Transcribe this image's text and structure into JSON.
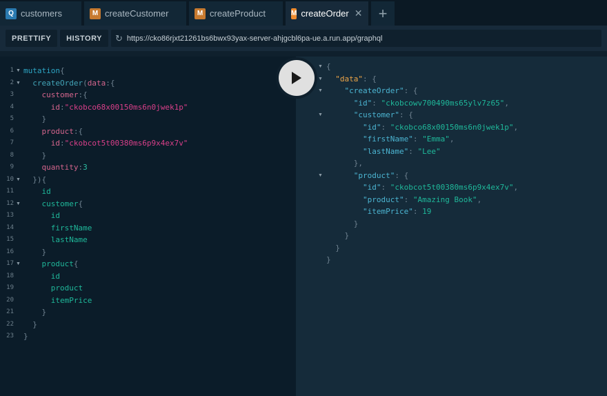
{
  "tabs": [
    {
      "badge": "Q",
      "label": "customers",
      "active": false
    },
    {
      "badge": "M",
      "label": "createCustomer",
      "active": false
    },
    {
      "badge": "M",
      "label": "createProduct",
      "active": false
    },
    {
      "badge": "M",
      "label": "createOrder",
      "active": true
    }
  ],
  "tab_add_label": "+",
  "tab_close_label": "✕",
  "toolbar": {
    "prettify_label": "PRETTIFY",
    "history_label": "HISTORY",
    "url": "https://cko86rjxt21261bs6bwx93yax-server-ahjgcbl6pa-ue.a.run.app/graphql"
  },
  "query_lines": [
    {
      "n": "1",
      "fold": true,
      "tokens": [
        [
          "kw",
          "mutation"
        ],
        [
          "pun",
          "{"
        ]
      ]
    },
    {
      "n": "2",
      "fold": true,
      "tokens": [
        [
          "pun",
          "  "
        ],
        [
          "fn",
          "createOrder"
        ],
        [
          "pun",
          "("
        ],
        [
          "arg",
          "data"
        ],
        [
          "pun",
          ":{"
        ]
      ]
    },
    {
      "n": "3",
      "fold": false,
      "tokens": [
        [
          "pun",
          "    "
        ],
        [
          "arg",
          "customer"
        ],
        [
          "pun",
          ":{"
        ]
      ]
    },
    {
      "n": "4",
      "fold": false,
      "tokens": [
        [
          "pun",
          "      "
        ],
        [
          "arg",
          "id"
        ],
        [
          "pun",
          ":"
        ],
        [
          "str",
          "\"ckobco68x00150ms6n0jwek1p\""
        ]
      ]
    },
    {
      "n": "5",
      "fold": false,
      "tokens": [
        [
          "pun",
          "    }"
        ]
      ]
    },
    {
      "n": "6",
      "fold": false,
      "tokens": [
        [
          "pun",
          "    "
        ],
        [
          "arg",
          "product"
        ],
        [
          "pun",
          ":{"
        ]
      ]
    },
    {
      "n": "7",
      "fold": false,
      "tokens": [
        [
          "pun",
          "      "
        ],
        [
          "arg",
          "id"
        ],
        [
          "pun",
          ":"
        ],
        [
          "str",
          "\"ckobcot5t00380ms6p9x4ex7v\""
        ]
      ]
    },
    {
      "n": "8",
      "fold": false,
      "tokens": [
        [
          "pun",
          "    }"
        ]
      ]
    },
    {
      "n": "9",
      "fold": false,
      "tokens": [
        [
          "pun",
          "    "
        ],
        [
          "arg",
          "quantity"
        ],
        [
          "pun",
          ":"
        ],
        [
          "num",
          "3"
        ]
      ]
    },
    {
      "n": "10",
      "fold": true,
      "tokens": [
        [
          "pun",
          "  }){"
        ]
      ]
    },
    {
      "n": "11",
      "fold": false,
      "tokens": [
        [
          "pun",
          "    "
        ],
        [
          "fld",
          "id"
        ]
      ]
    },
    {
      "n": "12",
      "fold": true,
      "tokens": [
        [
          "pun",
          "    "
        ],
        [
          "fld",
          "customer"
        ],
        [
          "pun",
          "{"
        ]
      ]
    },
    {
      "n": "13",
      "fold": false,
      "tokens": [
        [
          "pun",
          "      "
        ],
        [
          "fld",
          "id"
        ]
      ]
    },
    {
      "n": "14",
      "fold": false,
      "tokens": [
        [
          "pun",
          "      "
        ],
        [
          "fld",
          "firstName"
        ]
      ]
    },
    {
      "n": "15",
      "fold": false,
      "tokens": [
        [
          "pun",
          "      "
        ],
        [
          "fld",
          "lastName"
        ]
      ]
    },
    {
      "n": "16",
      "fold": false,
      "tokens": [
        [
          "pun",
          "    }"
        ]
      ]
    },
    {
      "n": "17",
      "fold": true,
      "tokens": [
        [
          "pun",
          "    "
        ],
        [
          "fld",
          "product"
        ],
        [
          "pun",
          "{"
        ]
      ]
    },
    {
      "n": "18",
      "fold": false,
      "tokens": [
        [
          "pun",
          "      "
        ],
        [
          "fld",
          "id"
        ]
      ]
    },
    {
      "n": "19",
      "fold": false,
      "tokens": [
        [
          "pun",
          "      "
        ],
        [
          "fld",
          "product"
        ]
      ]
    },
    {
      "n": "20",
      "fold": false,
      "tokens": [
        [
          "pun",
          "      "
        ],
        [
          "fld",
          "itemPrice"
        ]
      ]
    },
    {
      "n": "21",
      "fold": false,
      "tokens": [
        [
          "pun",
          "    }"
        ]
      ]
    },
    {
      "n": "22",
      "fold": false,
      "tokens": [
        [
          "pun",
          "  }"
        ]
      ]
    },
    {
      "n": "23",
      "fold": false,
      "tokens": [
        [
          "pun",
          "}"
        ]
      ]
    }
  ],
  "result_lines": [
    {
      "fold": true,
      "tokens": [
        [
          "pun",
          "{"
        ]
      ]
    },
    {
      "fold": true,
      "tokens": [
        [
          "pun",
          "  "
        ],
        [
          "jkey2",
          "\"data\""
        ],
        [
          "pun",
          ": {"
        ]
      ]
    },
    {
      "fold": true,
      "tokens": [
        [
          "pun",
          "    "
        ],
        [
          "jkey",
          "\"createOrder\""
        ],
        [
          "pun",
          ": {"
        ]
      ]
    },
    {
      "fold": false,
      "tokens": [
        [
          "pun",
          "      "
        ],
        [
          "jkey",
          "\"id\""
        ],
        [
          "pun",
          ": "
        ],
        [
          "jstr",
          "\"ckobcowv700490ms65ylv7z65\""
        ],
        [
          "pun",
          ","
        ]
      ]
    },
    {
      "fold": true,
      "tokens": [
        [
          "pun",
          "      "
        ],
        [
          "jkey",
          "\"customer\""
        ],
        [
          "pun",
          ": {"
        ]
      ]
    },
    {
      "fold": false,
      "tokens": [
        [
          "pun",
          "        "
        ],
        [
          "jkey",
          "\"id\""
        ],
        [
          "pun",
          ": "
        ],
        [
          "jstr",
          "\"ckobco68x00150ms6n0jwek1p\""
        ],
        [
          "pun",
          ","
        ]
      ]
    },
    {
      "fold": false,
      "tokens": [
        [
          "pun",
          "        "
        ],
        [
          "jkey",
          "\"firstName\""
        ],
        [
          "pun",
          ": "
        ],
        [
          "jstr",
          "\"Emma\""
        ],
        [
          "pun",
          ","
        ]
      ]
    },
    {
      "fold": false,
      "tokens": [
        [
          "pun",
          "        "
        ],
        [
          "jkey",
          "\"lastName\""
        ],
        [
          "pun",
          ": "
        ],
        [
          "jstr",
          "\"Lee\""
        ]
      ]
    },
    {
      "fold": false,
      "tokens": [
        [
          "pun",
          "      },"
        ]
      ]
    },
    {
      "fold": true,
      "tokens": [
        [
          "pun",
          "      "
        ],
        [
          "jkey",
          "\"product\""
        ],
        [
          "pun",
          ": {"
        ]
      ]
    },
    {
      "fold": false,
      "tokens": [
        [
          "pun",
          "        "
        ],
        [
          "jkey",
          "\"id\""
        ],
        [
          "pun",
          ": "
        ],
        [
          "jstr",
          "\"ckobcot5t00380ms6p9x4ex7v\""
        ],
        [
          "pun",
          ","
        ]
      ]
    },
    {
      "fold": false,
      "tokens": [
        [
          "pun",
          "        "
        ],
        [
          "jkey",
          "\"product\""
        ],
        [
          "pun",
          ": "
        ],
        [
          "jstr",
          "\"Amazing Book\""
        ],
        [
          "pun",
          ","
        ]
      ]
    },
    {
      "fold": false,
      "tokens": [
        [
          "pun",
          "        "
        ],
        [
          "jkey",
          "\"itemPrice\""
        ],
        [
          "pun",
          ": "
        ],
        [
          "jnum",
          "19"
        ]
      ]
    },
    {
      "fold": false,
      "tokens": [
        [
          "pun",
          "      }"
        ]
      ]
    },
    {
      "fold": false,
      "tokens": [
        [
          "pun",
          "    }"
        ]
      ]
    },
    {
      "fold": false,
      "tokens": [
        [
          "pun",
          "  }"
        ]
      ]
    },
    {
      "fold": false,
      "tokens": [
        [
          "pun",
          "}"
        ]
      ]
    }
  ],
  "colors": {
    "background": "#0f202d",
    "tab_active_badge": "#f08c2e",
    "query_badge": "#2a7ab0"
  }
}
